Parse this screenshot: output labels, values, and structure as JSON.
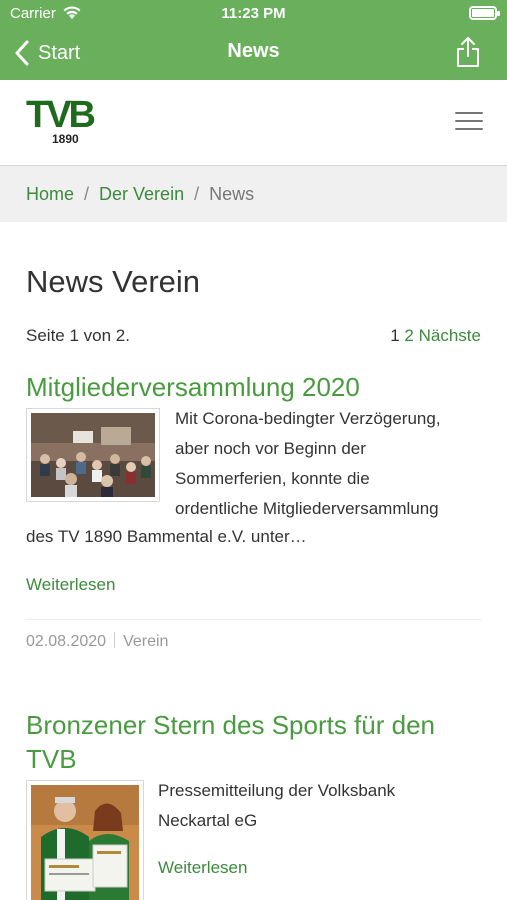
{
  "status": {
    "carrier": "Carrier",
    "time": "11:23 PM"
  },
  "nav": {
    "back_label": "Start",
    "title": "News"
  },
  "header": {
    "logo_text": "TVB",
    "logo_year": "1890"
  },
  "breadcrumb": {
    "items": [
      "Home",
      "Der Verein",
      "News"
    ],
    "separator": "/"
  },
  "page": {
    "title": "News Verein",
    "pager_text": "Seite 1 von 2.",
    "pager_current": "1",
    "pager_next_page": "2",
    "pager_next_label": "Nächste"
  },
  "articles": [
    {
      "title": "Mitgliederversammlung 2020",
      "excerpt_lines": [
        "Mit Corona-bedingter Verzögerung,",
        "aber noch vor Beginn der",
        "Sommerferien, konnte die",
        "ordentliche Mitgliederversammlung"
      ],
      "excerpt_tail": "des TV 1890 Bammental e.V. unter…",
      "read_more": "Weiterlesen",
      "date": "02.08.2020",
      "category": "Verein"
    },
    {
      "title_line1": "Bronzener Stern des Sports für den",
      "title_line2": "TVB",
      "excerpt_lines": [
        "Pressemitteilung der Volksbank",
        "Neckartal eG"
      ],
      "read_more": "Weiterlesen"
    }
  ],
  "colors": {
    "nav_bar": "#6aaf5c",
    "link_green": "#3c8a3c",
    "title_green": "#4a9b40",
    "logo_green": "#1e6b1e"
  }
}
